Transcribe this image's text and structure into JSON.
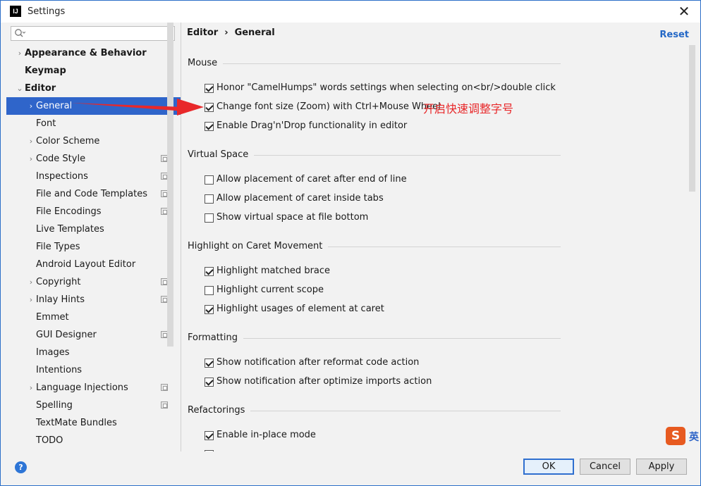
{
  "window": {
    "title": "Settings",
    "app_icon_text": "IJ",
    "close_glyph": "✕"
  },
  "search": {
    "placeholder": "",
    "value": ""
  },
  "tree": {
    "items": [
      {
        "label": "Appearance & Behavior",
        "level": 0,
        "bold": true,
        "chevron": "›",
        "selected": false,
        "project_icon": false
      },
      {
        "label": "Keymap",
        "level": 0,
        "bold": true,
        "chevron": "",
        "selected": false,
        "project_icon": false
      },
      {
        "label": "Editor",
        "level": 0,
        "bold": true,
        "chevron": "⌄",
        "selected": false,
        "project_icon": false
      },
      {
        "label": "General",
        "level": 1,
        "bold": false,
        "chevron": "›",
        "selected": true,
        "project_icon": false
      },
      {
        "label": "Font",
        "level": 1,
        "bold": false,
        "chevron": "",
        "selected": false,
        "project_icon": false
      },
      {
        "label": "Color Scheme",
        "level": 1,
        "bold": false,
        "chevron": "›",
        "selected": false,
        "project_icon": false
      },
      {
        "label": "Code Style",
        "level": 1,
        "bold": false,
        "chevron": "›",
        "selected": false,
        "project_icon": true
      },
      {
        "label": "Inspections",
        "level": 1,
        "bold": false,
        "chevron": "",
        "selected": false,
        "project_icon": true
      },
      {
        "label": "File and Code Templates",
        "level": 1,
        "bold": false,
        "chevron": "",
        "selected": false,
        "project_icon": true
      },
      {
        "label": "File Encodings",
        "level": 1,
        "bold": false,
        "chevron": "",
        "selected": false,
        "project_icon": true
      },
      {
        "label": "Live Templates",
        "level": 1,
        "bold": false,
        "chevron": "",
        "selected": false,
        "project_icon": false
      },
      {
        "label": "File Types",
        "level": 1,
        "bold": false,
        "chevron": "",
        "selected": false,
        "project_icon": false
      },
      {
        "label": "Android Layout Editor",
        "level": 1,
        "bold": false,
        "chevron": "",
        "selected": false,
        "project_icon": false
      },
      {
        "label": "Copyright",
        "level": 1,
        "bold": false,
        "chevron": "›",
        "selected": false,
        "project_icon": true
      },
      {
        "label": "Inlay Hints",
        "level": 1,
        "bold": false,
        "chevron": "›",
        "selected": false,
        "project_icon": true
      },
      {
        "label": "Emmet",
        "level": 1,
        "bold": false,
        "chevron": "",
        "selected": false,
        "project_icon": false
      },
      {
        "label": "GUI Designer",
        "level": 1,
        "bold": false,
        "chevron": "",
        "selected": false,
        "project_icon": true
      },
      {
        "label": "Images",
        "level": 1,
        "bold": false,
        "chevron": "",
        "selected": false,
        "project_icon": false
      },
      {
        "label": "Intentions",
        "level": 1,
        "bold": false,
        "chevron": "",
        "selected": false,
        "project_icon": false
      },
      {
        "label": "Language Injections",
        "level": 1,
        "bold": false,
        "chevron": "›",
        "selected": false,
        "project_icon": true
      },
      {
        "label": "Spelling",
        "level": 1,
        "bold": false,
        "chevron": "",
        "selected": false,
        "project_icon": true
      },
      {
        "label": "TextMate Bundles",
        "level": 1,
        "bold": false,
        "chevron": "",
        "selected": false,
        "project_icon": false
      },
      {
        "label": "TODO",
        "level": 1,
        "bold": false,
        "chevron": "",
        "selected": false,
        "project_icon": false
      }
    ]
  },
  "breadcrumb": {
    "parent": "Editor",
    "separator": "›",
    "current": "General"
  },
  "reset_label": "Reset",
  "sections": {
    "mouse": {
      "title": "Mouse",
      "options": [
        {
          "label": "Honor \"CamelHumps\" words settings when selecting on<br/>double click",
          "checked": true
        },
        {
          "label": "Change font size (Zoom) with Ctrl+Mouse Wheel",
          "checked": true
        },
        {
          "label": "Enable Drag'n'Drop functionality in editor",
          "checked": true
        }
      ]
    },
    "virtual_space": {
      "title": "Virtual Space",
      "options": [
        {
          "label": "Allow placement of caret after end of line",
          "checked": false
        },
        {
          "label": "Allow placement of caret inside tabs",
          "checked": false
        },
        {
          "label": "Show virtual space at file bottom",
          "checked": false
        }
      ]
    },
    "highlight": {
      "title": "Highlight on Caret Movement",
      "options": [
        {
          "label": "Highlight matched brace",
          "checked": true
        },
        {
          "label": "Highlight current scope",
          "checked": false
        },
        {
          "label": "Highlight usages of element at caret",
          "checked": true
        }
      ]
    },
    "formatting": {
      "title": "Formatting",
      "options": [
        {
          "label": "Show notification after reformat code action",
          "checked": true
        },
        {
          "label": "Show notification after optimize imports action",
          "checked": true
        }
      ]
    },
    "refactorings": {
      "title": "Refactorings",
      "options": [
        {
          "label": "Enable in-place mode",
          "checked": true
        }
      ]
    }
  },
  "annotation": "开启快速调整字号",
  "footer": {
    "help_glyph": "?",
    "ok_label": "OK",
    "cancel_label": "Cancel",
    "apply_label": "Apply"
  },
  "ime": {
    "logo": "S",
    "label": "英"
  },
  "colors": {
    "selection": "#2f65ca",
    "link": "#2468c6",
    "annotation": "#e8282a",
    "arrow": "#e8282a"
  }
}
